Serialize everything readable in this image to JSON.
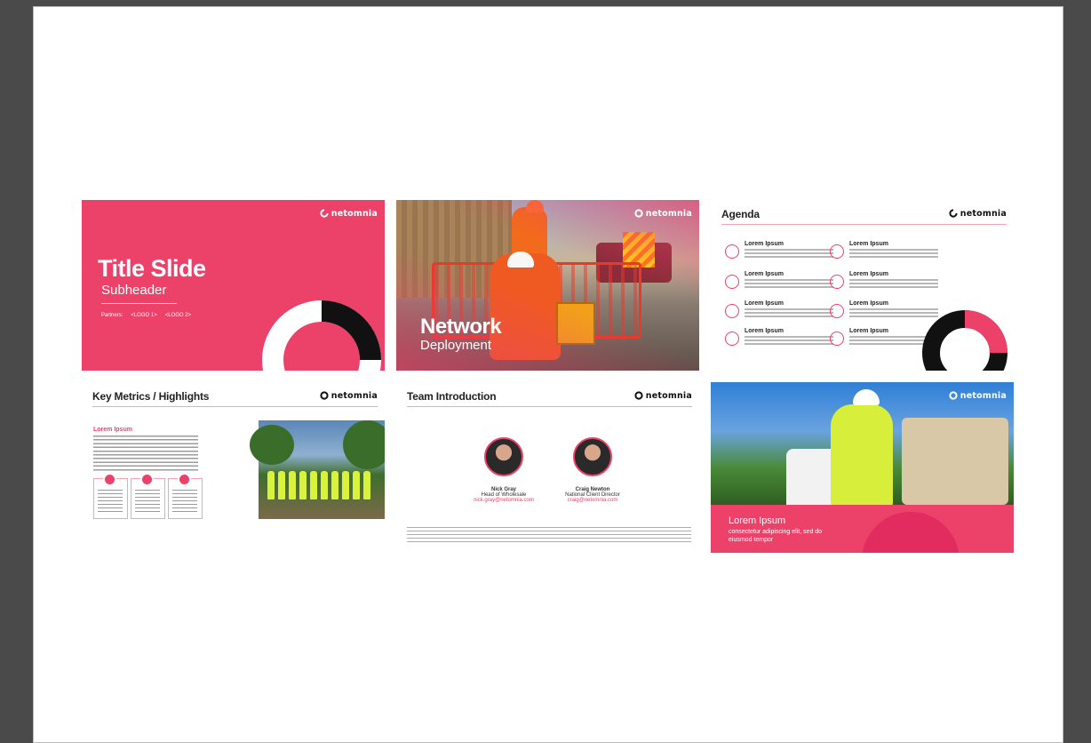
{
  "brand": {
    "name": "netomnia",
    "accent": "#ec4169"
  },
  "slides": {
    "title": {
      "title": "Title Slide",
      "subheader": "Subheader",
      "partners_label": "Partners:",
      "logo1": "<LOGO 1>",
      "logo2": "<LOGO 2>"
    },
    "network": {
      "line1": "Network",
      "line2": "Deployment"
    },
    "agenda": {
      "title": "Agenda",
      "item_title": "Lorem Ipsum"
    },
    "metrics": {
      "title": "Key Metrics / Highlights",
      "section": "Lorem Ipsum"
    },
    "team": {
      "title": "Team Introduction",
      "members": [
        {
          "name": "Nick Gray",
          "role": "Head of Wholesale",
          "email": "nick.gray@netomnia.com"
        },
        {
          "name": "Craig Newton",
          "role": "National Client Director",
          "email": "craig@netomnia.com"
        }
      ]
    },
    "closing": {
      "title": "Lorem Ipsum",
      "body": "consectetur adipiscing elit, sed do eiusmod tempor"
    }
  }
}
